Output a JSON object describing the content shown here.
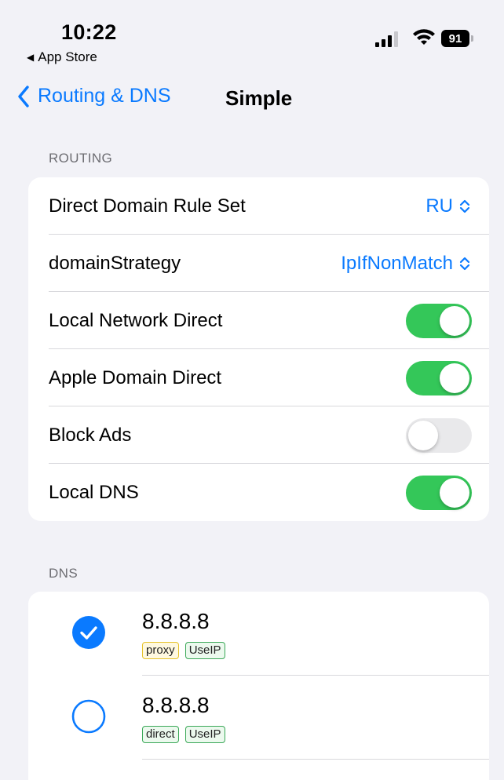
{
  "status": {
    "time": "10:22",
    "back_app": "App Store",
    "battery": "91"
  },
  "nav": {
    "back_label": "Routing & DNS",
    "title": "Simple"
  },
  "routing": {
    "header": "ROUTING",
    "rows": [
      {
        "label": "Direct Domain Rule Set",
        "value": "RU"
      },
      {
        "label": "domainStrategy",
        "value": "IpIfNonMatch"
      },
      {
        "label": "Local Network Direct",
        "toggle": true
      },
      {
        "label": "Apple Domain Direct",
        "toggle": true
      },
      {
        "label": "Block Ads",
        "toggle": false
      },
      {
        "label": "Local DNS",
        "toggle": true
      }
    ]
  },
  "dns": {
    "header": "DNS",
    "items": [
      {
        "address": "8.8.8.8",
        "selected": true,
        "tags": [
          "proxy",
          "UseIP"
        ]
      },
      {
        "address": "8.8.8.8",
        "selected": false,
        "tags": [
          "direct",
          "UseIP"
        ]
      }
    ]
  },
  "colors": {
    "accent": "#0a7aff",
    "toggle_on": "#34c759",
    "toggle_off": "#e9e9eb",
    "background": "#f2f2f7"
  }
}
